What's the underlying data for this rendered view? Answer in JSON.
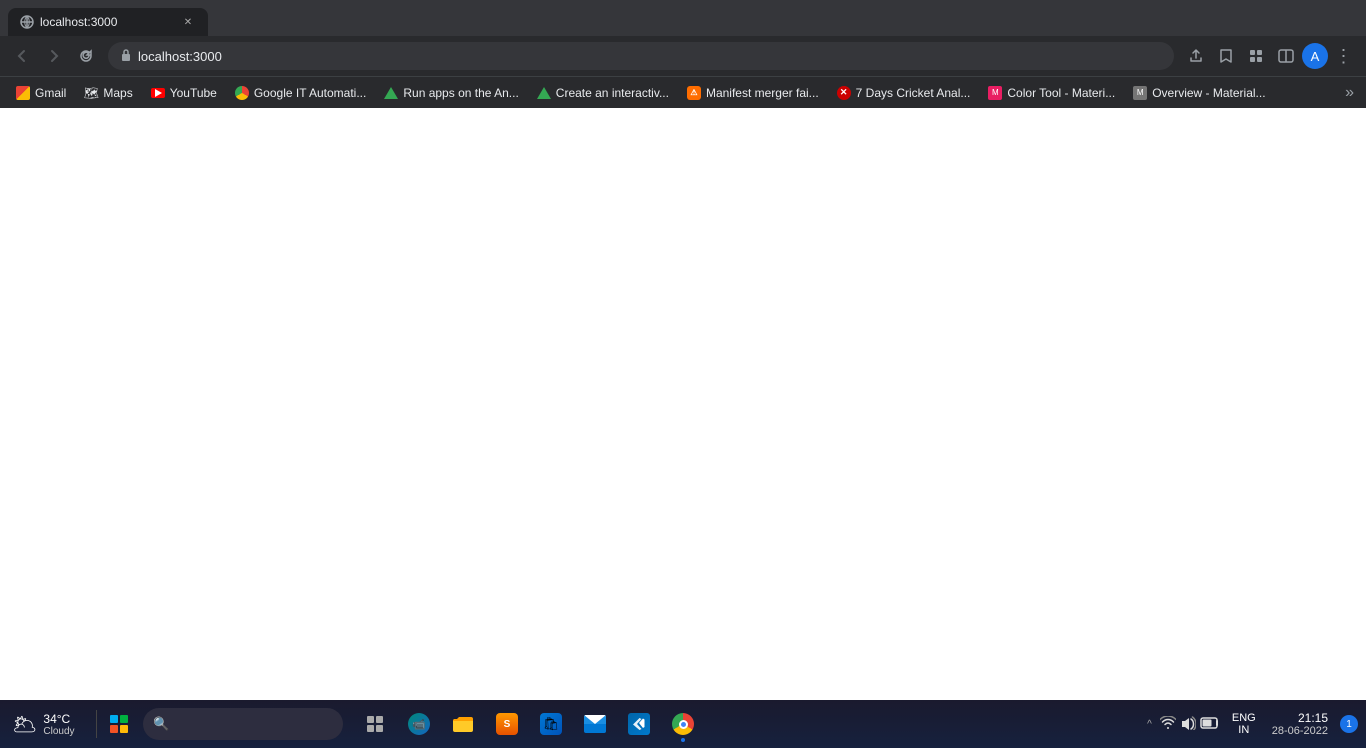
{
  "browser": {
    "tab": {
      "title": "localhost:3000",
      "favicon": "globe"
    },
    "address_bar": {
      "url": "localhost:3000",
      "protocol_icon": "🔒"
    },
    "nav_buttons": {
      "back": "←",
      "forward": "→",
      "refresh": "↻"
    },
    "nav_icons": {
      "share": "↑",
      "bookmark": "☆",
      "extensions": "🧩",
      "split": "⊡",
      "profile": "A",
      "menu": "⋮"
    }
  },
  "bookmarks": [
    {
      "id": "gmail",
      "label": "Gmail",
      "favicon_type": "gmail"
    },
    {
      "id": "maps",
      "label": "Maps",
      "favicon_type": "maps"
    },
    {
      "id": "youtube",
      "label": "YouTube",
      "favicon_type": "youtube"
    },
    {
      "id": "google-it",
      "label": "Google IT Automati...",
      "favicon_type": "chrome"
    },
    {
      "id": "run-apps",
      "label": "Run apps on the An...",
      "favicon_type": "green"
    },
    {
      "id": "create-interactive",
      "label": "Create an interactiv...",
      "favicon_type": "green"
    },
    {
      "id": "manifest",
      "label": "Manifest merger fai...",
      "favicon_type": "devtools"
    },
    {
      "id": "cricket",
      "label": "7 Days Cricket Anal...",
      "favicon_type": "x"
    },
    {
      "id": "color-tool",
      "label": "Color Tool - Materi...",
      "favicon_type": "material-color"
    },
    {
      "id": "overview",
      "label": "Overview - Material...",
      "favicon_type": "material-grey"
    }
  ],
  "page": {
    "background": "#ffffff",
    "content": ""
  },
  "taskbar": {
    "weather": {
      "temperature": "34°C",
      "condition": "Cloudy",
      "icon": "🌥"
    },
    "icons": [
      {
        "id": "start",
        "label": "Start",
        "type": "windows"
      },
      {
        "id": "search",
        "label": "Search",
        "type": "search"
      },
      {
        "id": "task-view",
        "label": "Task View",
        "icon": "⬚"
      },
      {
        "id": "meet",
        "label": "Google Meet",
        "icon": "📹"
      },
      {
        "id": "file-explorer",
        "label": "File Explorer",
        "icon": "📁"
      },
      {
        "id": "sublime",
        "label": "Sublime Text",
        "icon": "𝕊"
      },
      {
        "id": "ms-store",
        "label": "Microsoft Store",
        "icon": "🛍"
      },
      {
        "id": "mail",
        "label": "Mail",
        "icon": "📧"
      },
      {
        "id": "vscode",
        "label": "Visual Studio Code",
        "icon": "⬡"
      },
      {
        "id": "chrome",
        "label": "Google Chrome",
        "icon": "●",
        "active": true
      }
    ],
    "tray": {
      "up_arrow": "^",
      "network_icon": "📶",
      "volume_icon": "🔊",
      "battery_icon": "🔋",
      "language": "ENG",
      "region": "IN",
      "time": "21:15",
      "date": "28-06-2022",
      "notification_count": "1"
    }
  }
}
